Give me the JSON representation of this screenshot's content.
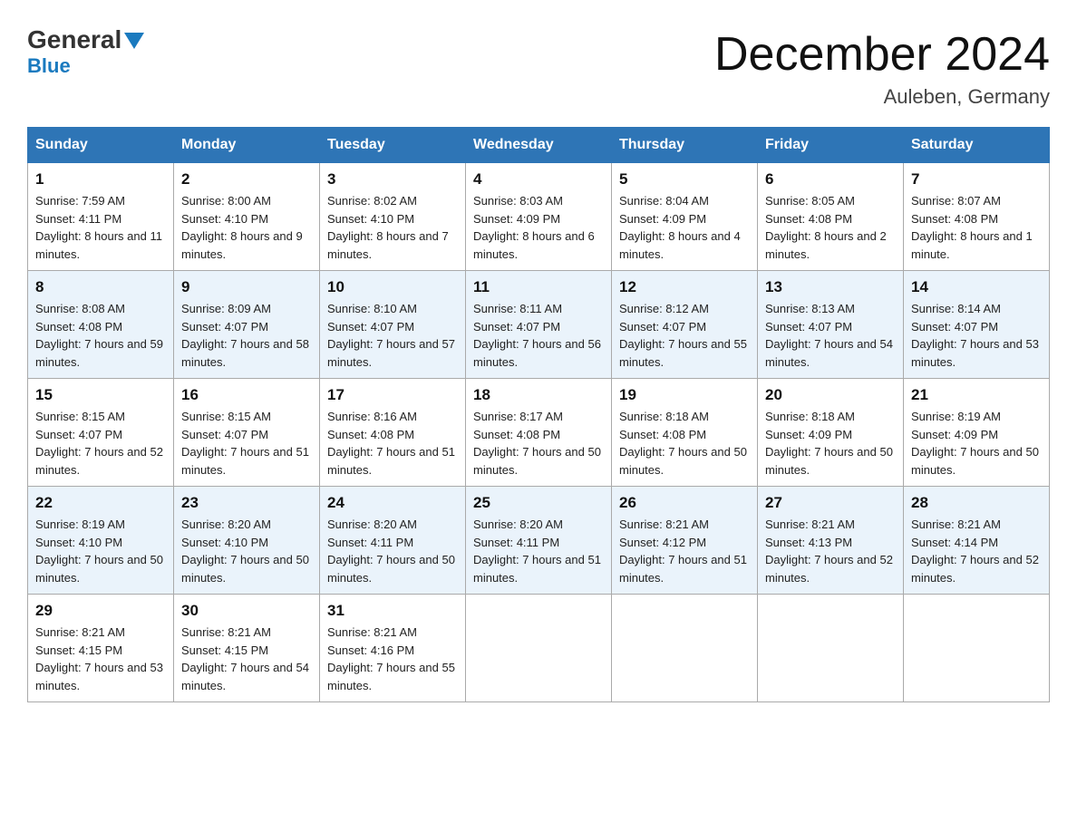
{
  "header": {
    "logo_main": "General",
    "logo_sub": "Blue",
    "month_title": "December 2024",
    "location": "Auleben, Germany"
  },
  "days_of_week": [
    "Sunday",
    "Monday",
    "Tuesday",
    "Wednesday",
    "Thursday",
    "Friday",
    "Saturday"
  ],
  "weeks": [
    [
      {
        "day": "1",
        "sunrise": "7:59 AM",
        "sunset": "4:11 PM",
        "daylight": "8 hours and 11 minutes."
      },
      {
        "day": "2",
        "sunrise": "8:00 AM",
        "sunset": "4:10 PM",
        "daylight": "8 hours and 9 minutes."
      },
      {
        "day": "3",
        "sunrise": "8:02 AM",
        "sunset": "4:10 PM",
        "daylight": "8 hours and 7 minutes."
      },
      {
        "day": "4",
        "sunrise": "8:03 AM",
        "sunset": "4:09 PM",
        "daylight": "8 hours and 6 minutes."
      },
      {
        "day": "5",
        "sunrise": "8:04 AM",
        "sunset": "4:09 PM",
        "daylight": "8 hours and 4 minutes."
      },
      {
        "day": "6",
        "sunrise": "8:05 AM",
        "sunset": "4:08 PM",
        "daylight": "8 hours and 2 minutes."
      },
      {
        "day": "7",
        "sunrise": "8:07 AM",
        "sunset": "4:08 PM",
        "daylight": "8 hours and 1 minute."
      }
    ],
    [
      {
        "day": "8",
        "sunrise": "8:08 AM",
        "sunset": "4:08 PM",
        "daylight": "7 hours and 59 minutes."
      },
      {
        "day": "9",
        "sunrise": "8:09 AM",
        "sunset": "4:07 PM",
        "daylight": "7 hours and 58 minutes."
      },
      {
        "day": "10",
        "sunrise": "8:10 AM",
        "sunset": "4:07 PM",
        "daylight": "7 hours and 57 minutes."
      },
      {
        "day": "11",
        "sunrise": "8:11 AM",
        "sunset": "4:07 PM",
        "daylight": "7 hours and 56 minutes."
      },
      {
        "day": "12",
        "sunrise": "8:12 AM",
        "sunset": "4:07 PM",
        "daylight": "7 hours and 55 minutes."
      },
      {
        "day": "13",
        "sunrise": "8:13 AM",
        "sunset": "4:07 PM",
        "daylight": "7 hours and 54 minutes."
      },
      {
        "day": "14",
        "sunrise": "8:14 AM",
        "sunset": "4:07 PM",
        "daylight": "7 hours and 53 minutes."
      }
    ],
    [
      {
        "day": "15",
        "sunrise": "8:15 AM",
        "sunset": "4:07 PM",
        "daylight": "7 hours and 52 minutes."
      },
      {
        "day": "16",
        "sunrise": "8:15 AM",
        "sunset": "4:07 PM",
        "daylight": "7 hours and 51 minutes."
      },
      {
        "day": "17",
        "sunrise": "8:16 AM",
        "sunset": "4:08 PM",
        "daylight": "7 hours and 51 minutes."
      },
      {
        "day": "18",
        "sunrise": "8:17 AM",
        "sunset": "4:08 PM",
        "daylight": "7 hours and 50 minutes."
      },
      {
        "day": "19",
        "sunrise": "8:18 AM",
        "sunset": "4:08 PM",
        "daylight": "7 hours and 50 minutes."
      },
      {
        "day": "20",
        "sunrise": "8:18 AM",
        "sunset": "4:09 PM",
        "daylight": "7 hours and 50 minutes."
      },
      {
        "day": "21",
        "sunrise": "8:19 AM",
        "sunset": "4:09 PM",
        "daylight": "7 hours and 50 minutes."
      }
    ],
    [
      {
        "day": "22",
        "sunrise": "8:19 AM",
        "sunset": "4:10 PM",
        "daylight": "7 hours and 50 minutes."
      },
      {
        "day": "23",
        "sunrise": "8:20 AM",
        "sunset": "4:10 PM",
        "daylight": "7 hours and 50 minutes."
      },
      {
        "day": "24",
        "sunrise": "8:20 AM",
        "sunset": "4:11 PM",
        "daylight": "7 hours and 50 minutes."
      },
      {
        "day": "25",
        "sunrise": "8:20 AM",
        "sunset": "4:11 PM",
        "daylight": "7 hours and 51 minutes."
      },
      {
        "day": "26",
        "sunrise": "8:21 AM",
        "sunset": "4:12 PM",
        "daylight": "7 hours and 51 minutes."
      },
      {
        "day": "27",
        "sunrise": "8:21 AM",
        "sunset": "4:13 PM",
        "daylight": "7 hours and 52 minutes."
      },
      {
        "day": "28",
        "sunrise": "8:21 AM",
        "sunset": "4:14 PM",
        "daylight": "7 hours and 52 minutes."
      }
    ],
    [
      {
        "day": "29",
        "sunrise": "8:21 AM",
        "sunset": "4:15 PM",
        "daylight": "7 hours and 53 minutes."
      },
      {
        "day": "30",
        "sunrise": "8:21 AM",
        "sunset": "4:15 PM",
        "daylight": "7 hours and 54 minutes."
      },
      {
        "day": "31",
        "sunrise": "8:21 AM",
        "sunset": "4:16 PM",
        "daylight": "7 hours and 55 minutes."
      },
      null,
      null,
      null,
      null
    ]
  ]
}
